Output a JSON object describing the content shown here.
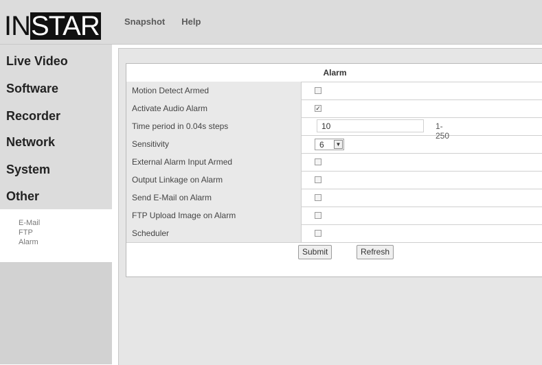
{
  "logo": {
    "part1": "IN",
    "part2": "STAR"
  },
  "topnav": {
    "snapshot": "Snapshot",
    "help": "Help"
  },
  "sidebar": {
    "items": [
      {
        "label": "Live Video"
      },
      {
        "label": "Software"
      },
      {
        "label": "Recorder"
      },
      {
        "label": "Network"
      },
      {
        "label": "System"
      },
      {
        "label": "Other"
      }
    ],
    "subitems": [
      {
        "label": "E-Mail"
      },
      {
        "label": "FTP"
      },
      {
        "label": "Alarm"
      }
    ]
  },
  "panel": {
    "title": "Alarm",
    "rows": [
      {
        "label": "Motion Detect Armed",
        "type": "checkbox",
        "checked": false
      },
      {
        "label": "Activate Audio Alarm",
        "type": "checkbox",
        "checked": true
      },
      {
        "label": "Time period in 0.04s steps",
        "type": "text",
        "value": "10",
        "range": "1-250"
      },
      {
        "label": "Sensitivity",
        "type": "select",
        "value": "6"
      },
      {
        "label": "External Alarm Input Armed",
        "type": "checkbox",
        "checked": false
      },
      {
        "label": "Output Linkage on Alarm",
        "type": "checkbox",
        "checked": false
      },
      {
        "label": "Send E-Mail on Alarm",
        "type": "checkbox",
        "checked": false
      },
      {
        "label": "FTP Upload Image on Alarm",
        "type": "checkbox",
        "checked": false
      },
      {
        "label": "Scheduler",
        "type": "checkbox",
        "checked": false
      }
    ],
    "submit": "Submit",
    "refresh": "Refresh"
  },
  "colors": {
    "header_bg": "#dcdcdc",
    "sidebar_bg": "#dcdcdc",
    "label_bg": "#e9e9e9"
  }
}
